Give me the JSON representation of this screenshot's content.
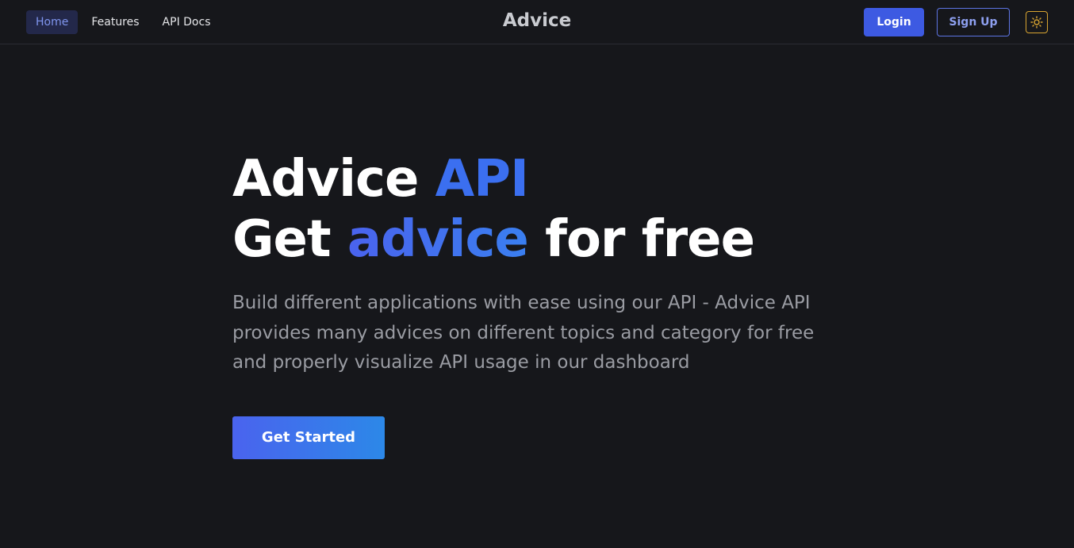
{
  "nav": {
    "links": [
      {
        "label": "Home",
        "active": true
      },
      {
        "label": "Features",
        "active": false
      },
      {
        "label": "API Docs",
        "active": false
      }
    ],
    "brand": "Advice",
    "login_label": "Login",
    "signup_label": "Sign Up",
    "theme_icon": "sun-icon"
  },
  "hero": {
    "line1_part1": "Advice ",
    "line1_accent": "API",
    "line2_part1": "Get ",
    "line2_accent": "advice",
    "line2_part2": " for free",
    "description": "Build different applications with ease using our API - Advice API provides many advices on different topics and category for free and properly visualize API usage in our dashboard",
    "cta_label": "Get Started"
  },
  "colors": {
    "background": "#16171b",
    "accent": "#3b6ff0",
    "login_bg": "#3d5ae2",
    "theme_toggle": "#d8a431"
  }
}
